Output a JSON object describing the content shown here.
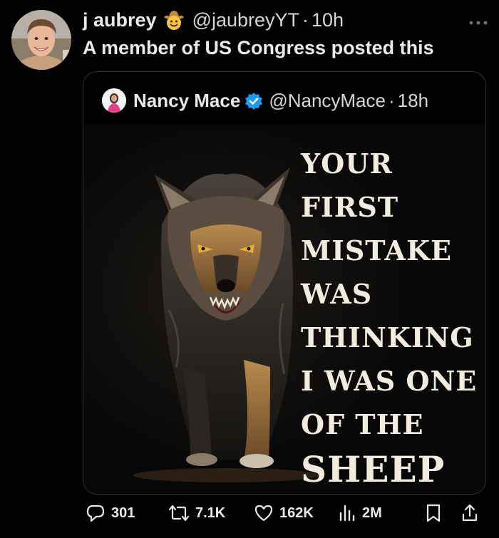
{
  "post": {
    "display_name": "j aubrey",
    "badge_icon": "cowboy-face-emoji-icon",
    "handle": "@jaubreyYT",
    "separator": "·",
    "time": "10h",
    "text": "A member of US Congress posted this",
    "more_icon": "more-dots-icon"
  },
  "quote": {
    "display_name": "Nancy Mace",
    "verified_icon": "verified-badge-icon",
    "handle": "@NancyMace",
    "separator": "·",
    "time": "18h",
    "image": {
      "description_icon": "wolf-image",
      "lines": [
        "YOUR",
        "FIRST",
        "MISTAKE",
        "WAS",
        "THINKING",
        "I WAS ONE",
        "OF THE"
      ],
      "last_line": "SHEEP"
    }
  },
  "actions": {
    "replies": "301",
    "reposts": "7.1K",
    "likes": "162K",
    "views": "2M"
  },
  "colors": {
    "background": "#000000",
    "text": "#e7e9ea",
    "border": "#2f3336",
    "verified": "#1d9bf0",
    "poster_text": "#f2ece0"
  }
}
